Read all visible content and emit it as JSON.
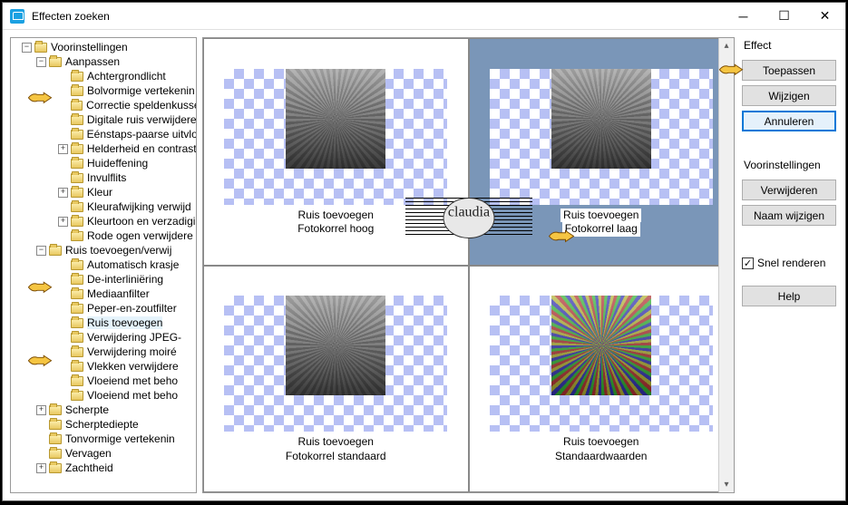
{
  "window": {
    "title": "Effecten zoeken"
  },
  "tree": {
    "root": "Voorinstellingen",
    "group_aanpassen": "Aanpassen",
    "items_aanpassen": [
      "Achtergrondlicht",
      "Bolvormige vertekenin",
      "Correctie speldenkusse",
      "Digitale ruis verwijdere",
      "Eénstaps-paarse uitvlo",
      "Helderheid en contrast",
      "Huideffening",
      "Invulflits",
      "Kleur",
      "Kleurafwijking verwijd",
      "Kleurtoon en verzadigi",
      "Rode ogen verwijdere"
    ],
    "group_ruis": "Ruis toevoegen/verwij",
    "items_ruis": [
      "Automatisch krasje",
      "De-interliniëring",
      "Mediaanfilter",
      "Peper-en-zoutfilter",
      "Ruis toevoegen",
      "Verwijdering JPEG-",
      "Verwijdering moiré",
      "Vlekken verwijdere",
      "Vloeiend met beho",
      "Vloeiend met beho"
    ],
    "rest": [
      "Scherpte",
      "Scherptediepte",
      "Tonvormige vertekenin",
      "Vervagen",
      "Zachtheid"
    ]
  },
  "previews": {
    "p1": {
      "line1": "Ruis toevoegen",
      "line2": "Fotokorrel hoog"
    },
    "p2": {
      "line1": "Ruis toevoegen",
      "line2": "Fotokorrel laag"
    },
    "p3": {
      "line1": "Ruis toevoegen",
      "line2": "Fotokorrel standaard"
    },
    "p4": {
      "line1": "Ruis toevoegen",
      "line2": "Standaardwaarden"
    }
  },
  "right": {
    "effect_label": "Effect",
    "apply": "Toepassen",
    "modify": "Wijzigen",
    "cancel": "Annuleren",
    "presets_label": "Voorinstellingen",
    "delete": "Verwijderen",
    "rename": "Naam wijzigen",
    "fast_render": "Snel renderen",
    "help": "Help"
  },
  "watermark": "claudia"
}
